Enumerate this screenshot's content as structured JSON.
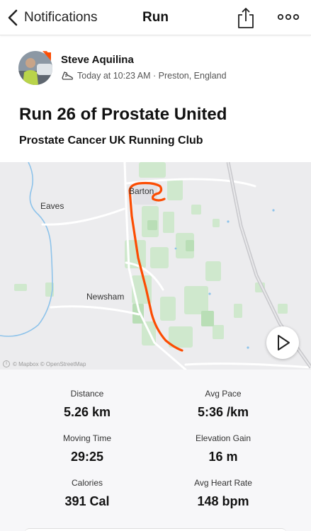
{
  "nav": {
    "back_label": "Notifications",
    "title": "Run"
  },
  "athlete": {
    "name": "Steve Aquilina",
    "meta": "Today at 10:23 AM · Preston, England"
  },
  "activity": {
    "title": "Run 26 of Prostate United",
    "club": "Prostate Cancer UK Running Club"
  },
  "map": {
    "places": [
      "Barton",
      "Eaves",
      "Newsham"
    ],
    "attribution": "© Mapbox © OpenStreetMap",
    "route_color": "#fc4c02"
  },
  "stats": [
    {
      "label": "Distance",
      "value": "5.26 km"
    },
    {
      "label": "Avg Pace",
      "value": "5:36 /km"
    },
    {
      "label": "Moving Time",
      "value": "29:25"
    },
    {
      "label": "Elevation Gain",
      "value": "16 m"
    },
    {
      "label": "Calories",
      "value": "391 Cal"
    },
    {
      "label": "Avg Heart Rate",
      "value": "148 bpm"
    }
  ],
  "icons": {
    "back": "chevron-left-icon",
    "share": "share-icon",
    "more": "more-horizontal-icon",
    "activity": "running-shoe-icon",
    "replay": "play-icon"
  }
}
